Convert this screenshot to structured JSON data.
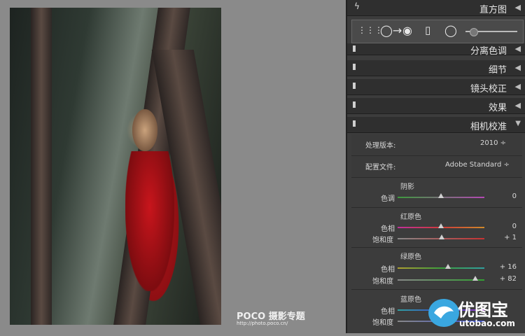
{
  "watermark": {
    "brand": "POCO 摄影专题",
    "url": "http://photo.poco.cn/"
  },
  "panel": {
    "top_header": {
      "label": "直方图"
    },
    "toolbar_tools": [
      "grid-icon",
      "circle-arrow-icon",
      "radial-dot-icon",
      "rect-icon",
      "circle-icon",
      "slider-icon"
    ],
    "sections": [
      {
        "label": "分离色调"
      },
      {
        "label": "细节"
      },
      {
        "label": "镜头校正"
      },
      {
        "label": "效果"
      },
      {
        "label": "相机校准"
      }
    ],
    "calibration": {
      "process_label": "处理版本:",
      "process_value": "2010 ÷",
      "profile_label": "配置文件:",
      "profile_value": "Adobe Standard ÷",
      "shadow": {
        "title": "阴影",
        "tint_label": "色调",
        "tint_value": "0"
      },
      "red": {
        "title": "红原色",
        "hue_label": "色相",
        "hue_value": "0",
        "sat_label": "饱和度",
        "sat_value": "+ 1"
      },
      "green": {
        "title": "绿原色",
        "hue_label": "色相",
        "hue_value": "+ 16",
        "sat_label": "饱和度",
        "sat_value": "+ 82"
      },
      "blue": {
        "title": "蓝原色",
        "hue_label": "色相",
        "sat_label": "饱和度"
      }
    }
  },
  "logo": {
    "text": "优图宝",
    "url": "utobao.com"
  }
}
